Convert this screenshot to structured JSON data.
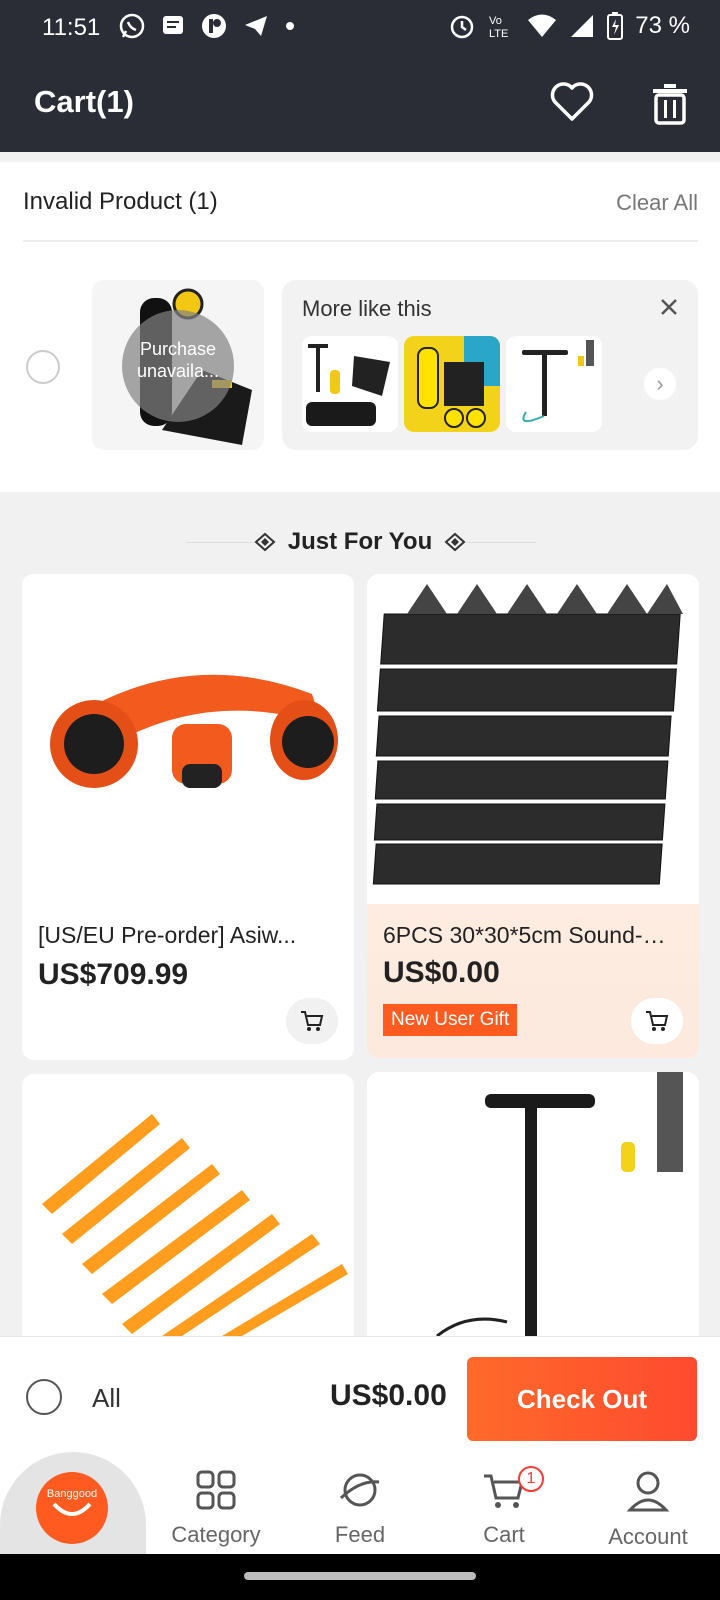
{
  "status": {
    "time": "11:51",
    "battery": "73 %",
    "left_icons": [
      "whatsapp-icon",
      "message-icon",
      "app-icon",
      "telegram-icon",
      "dot-icon"
    ],
    "right_icons": [
      "alarm-icon",
      "volte-icon",
      "wifi-icon",
      "signal-icon",
      "battery-icon"
    ]
  },
  "header": {
    "title": "Cart(1)"
  },
  "invalid": {
    "heading": "Invalid Product (1)",
    "clear_all": "Clear All",
    "overlay_text": "Purchase unavaila...",
    "more_like_label": "More like this",
    "next_glyph": "›"
  },
  "just_for_you": {
    "title": "Just For You"
  },
  "products": [
    {
      "name": "[US/EU Pre-order] Asiw...",
      "price": "US$709.99"
    },
    {
      "name": "6PCS 30*30*5cm Sound-a...",
      "price": "US$0.00",
      "badge": "New User Gift"
    },
    {
      "name": "",
      "price": ""
    },
    {
      "name": "",
      "price": ""
    }
  ],
  "bottom": {
    "all_label": "All",
    "total": "US$0.00",
    "checkout": "Check Out"
  },
  "nav": {
    "brand": "Banggood",
    "items": [
      {
        "label": "Category"
      },
      {
        "label": "Feed"
      },
      {
        "label": "Cart",
        "badge": "1"
      },
      {
        "label": "Account"
      }
    ]
  },
  "colors": {
    "header_bg": "#2a2c36",
    "accent": "#ff5a1f",
    "checkout_start": "#ff6a2a",
    "checkout_end": "#ff4a2f"
  }
}
